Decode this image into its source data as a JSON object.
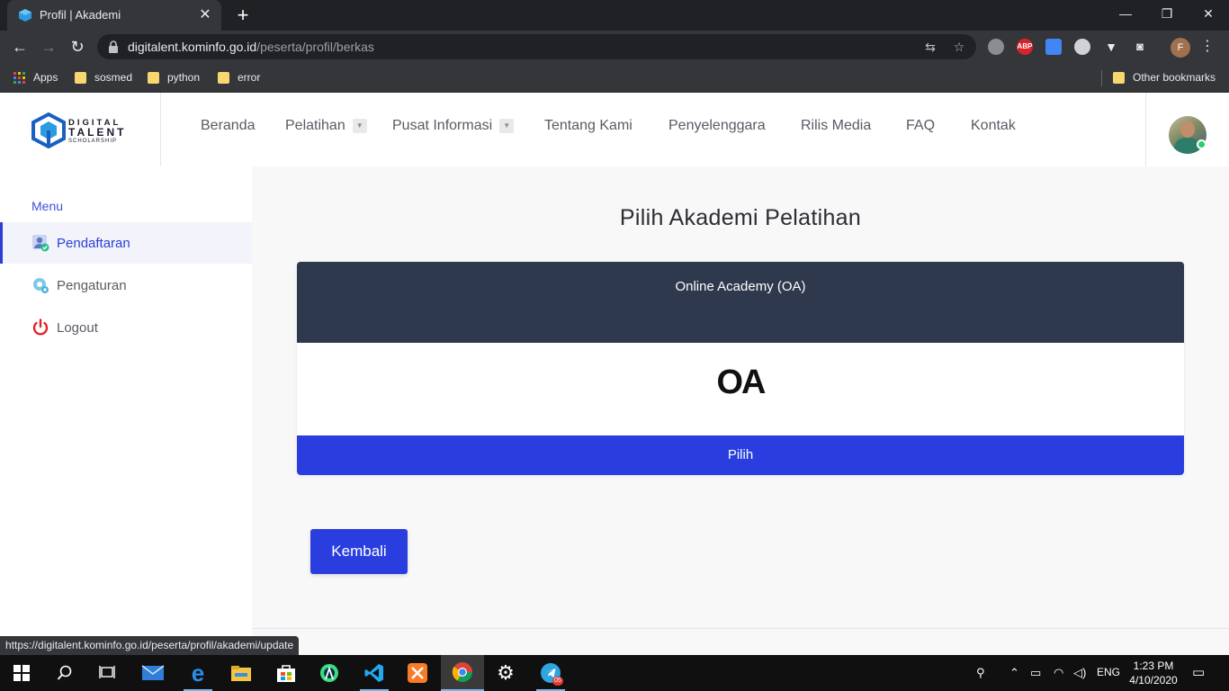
{
  "browser": {
    "tab_title": "Profil | Akademi",
    "tab_close": "✕",
    "new_tab": "+",
    "url_host": "digitalent.kominfo.go.id",
    "url_path": "/peserta/profil/berkas",
    "profile_initial": "F",
    "window_controls": {
      "minimize": "—",
      "restore": "❐",
      "close": "✕"
    },
    "ext_abp": "ABP"
  },
  "bookmarks": {
    "apps": "Apps",
    "items": [
      "sosmed",
      "python",
      "error"
    ],
    "other": "Other bookmarks"
  },
  "site": {
    "logo": {
      "line1": "DIGITAL",
      "line2": "TALENT",
      "line3": "SCHOLARSHIP"
    },
    "nav": [
      "Beranda",
      "Pelatihan",
      "Pusat Informasi",
      "Tentang Kami",
      "Penyelenggara",
      "Rilis Media",
      "FAQ",
      "Kontak"
    ],
    "caret": "▼"
  },
  "sidebar": {
    "heading": "Menu",
    "items": [
      "Pendaftaran",
      "Pengaturan",
      "Logout"
    ]
  },
  "main": {
    "title": "Pilih Akademi Pelatihan",
    "card": {
      "header": "Online Academy (OA)",
      "logo_text": "OA",
      "button": "Pilih"
    },
    "back_button": "Kembali"
  },
  "status_url": "https://digitalent.kominfo.go.id/peserta/profil/akademi/update",
  "taskbar": {
    "lang": "ENG",
    "time": "1:23 PM",
    "date": "4/10/2020",
    "telegram_badge": "05"
  },
  "colors": {
    "accent": "#2a3ee0",
    "card_header": "#2f394d",
    "sidebar_active_bg": "#f3f4fb",
    "chrome_dark": "#35363a"
  }
}
